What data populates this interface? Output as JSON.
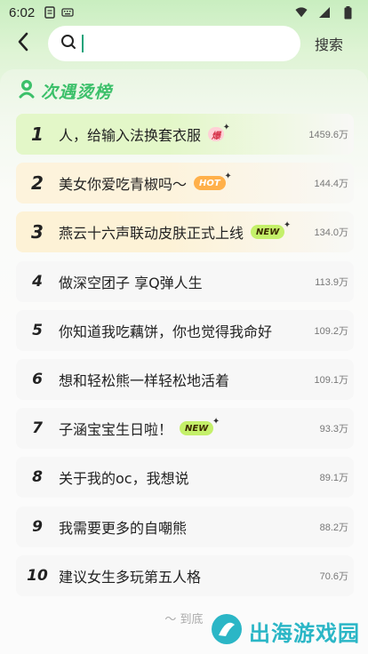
{
  "status_bar": {
    "time": "6:02"
  },
  "header": {
    "search_placeholder": "",
    "search_value": "",
    "search_button": "搜索"
  },
  "hot_list": {
    "title": "次遇烫榜",
    "items": [
      {
        "rank": "1",
        "title": "人，给输入法换套衣服",
        "badge": "爆",
        "count": "1459.6万"
      },
      {
        "rank": "2",
        "title": "美女你爱吃青椒吗～",
        "badge": "HOT",
        "count": "144.4万"
      },
      {
        "rank": "3",
        "title": "燕云十六声联动皮肤正式上线",
        "badge": "NEW",
        "count": "134.0万"
      },
      {
        "rank": "4",
        "title": "做深空团子 享Q弹人生",
        "badge": "",
        "count": "113.9万"
      },
      {
        "rank": "5",
        "title": "你知道我吃藕饼，你也觉得我命好",
        "badge": "",
        "count": "109.2万"
      },
      {
        "rank": "6",
        "title": "想和轻松熊一样轻松地活着",
        "badge": "",
        "count": "109.1万"
      },
      {
        "rank": "7",
        "title": "子涵宝宝生日啦！",
        "badge": "NEW",
        "count": "93.3万"
      },
      {
        "rank": "8",
        "title": "关于我的oc，我想说",
        "badge": "",
        "count": "89.1万"
      },
      {
        "rank": "9",
        "title": "我需要更多的自嘲熊",
        "badge": "",
        "count": "88.2万"
      },
      {
        "rank": "10",
        "title": "建议女生多玩第五人格",
        "badge": "",
        "count": "70.6万"
      }
    ],
    "end_text": "～ 到底"
  },
  "watermark": {
    "text": "出海游戏园"
  },
  "colors": {
    "accent_green": "#3cc06a",
    "rank1_bg": "#e3f7c8",
    "rank2_bg": "#fdf3dc",
    "rank3_bg": "#fdf2d6",
    "badge_bao": "#ffd0d6",
    "badge_hot": "#ffb04a",
    "badge_new": "#c4f06a"
  }
}
